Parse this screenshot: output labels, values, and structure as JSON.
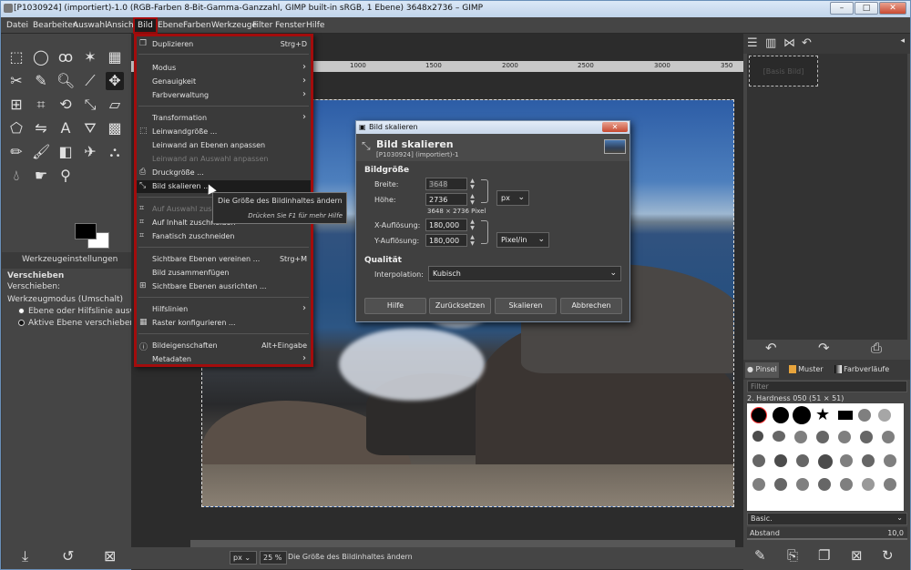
{
  "window": {
    "title": "[P1030924] (importiert)-1.0 (RGB-Farben 8-Bit-Gamma-Ganzzahl, GIMP built-in sRGB, 1 Ebene) 3648x2736 – GIMP",
    "min": "–",
    "max": "□",
    "close": "✕"
  },
  "menubar": [
    "Datei",
    "Bearbeiten",
    "Auswahl",
    "Ansicht",
    "Bild",
    "Ebene",
    "Farben",
    "Werkzeuge",
    "Filter",
    "Fenster",
    "Hilfe"
  ],
  "menu": {
    "items": [
      {
        "label": "Duplizieren",
        "accel": "Strg+D"
      },
      {
        "label": "Modus"
      },
      {
        "label": "Genauigkeit"
      },
      {
        "label": "Farbverwaltung"
      },
      {
        "label": "Transformation"
      },
      {
        "label": "Leinwandgröße ..."
      },
      {
        "label": "Leinwand an Ebenen anpassen"
      },
      {
        "label": "Leinwand an Auswahl anpassen"
      },
      {
        "label": "Druckgröße ..."
      },
      {
        "label": "Bild skalieren ..."
      },
      {
        "label": "Auf Auswahl zuschneiden"
      },
      {
        "label": "Auf Inhalt zuschneiden"
      },
      {
        "label": "Fanatisch zuschneiden"
      },
      {
        "label": "Sichtbare Ebenen vereinen ...",
        "accel": "Strg+M"
      },
      {
        "label": "Bild zusammenfügen"
      },
      {
        "label": "Sichtbare Ebenen ausrichten ..."
      },
      {
        "label": "Hilfslinien"
      },
      {
        "label": "Raster konfigurieren ..."
      },
      {
        "label": "Bildeigenschaften",
        "accel": "Alt+Eingabe"
      },
      {
        "label": "Metadaten"
      }
    ]
  },
  "tooltip": {
    "line1": "Die Größe des Bildinhaltes ändern",
    "line2": "Drücken Sie F1 für mehr Hilfe"
  },
  "toolbox": {
    "tab_label": "Werkzeugeinstellungen",
    "tool_title": "Verschieben",
    "move_label": "Verschieben:",
    "mode_label": "Werkzeugmodus (Umschalt)",
    "option1": "Ebene oder Hilfslinie auswählen",
    "option2": "Aktive Ebene verschieben"
  },
  "ruler": {
    "t1": "1000",
    "t2": "1500",
    "t3": "2000",
    "t4": "2500",
    "t5": "3000",
    "t6": "350"
  },
  "status": {
    "unit": "px",
    "zoom": "25 %",
    "text": "Die Größe des Bildinhaltes ändern"
  },
  "dialog": {
    "window_title": "Bild skalieren",
    "title": "Bild skalieren",
    "subtitle": "[P1030924] (importiert)-1",
    "size_section": "Bildgröße",
    "width_label": "Breite:",
    "width_value": "3648",
    "height_label": "Höhe:",
    "height_value": "2736",
    "size_unit": "px",
    "size_info": "3648 × 2736 Pixel",
    "xres_label": "X-Auflösung:",
    "xres_value": "180,000",
    "yres_label": "Y-Auflösung:",
    "yres_value": "180,000",
    "res_unit": "Pixel/in",
    "quality_section": "Qualität",
    "interp_label": "Interpolation:",
    "interp_value": "Kubisch",
    "buttons": [
      "Hilfe",
      "Zurücksetzen",
      "Skalieren",
      "Abbrechen"
    ]
  },
  "right": {
    "layer_name": "[Basis Bild]",
    "tabs": [
      "Pinsel",
      "Muster",
      "Farbverläufe"
    ],
    "filter_placeholder": "Filter",
    "brush_name": "2. Hardness 050 (51 × 51)",
    "brush_set": "Basic.",
    "spacing_label": "Abstand",
    "spacing_value": "10,0"
  }
}
